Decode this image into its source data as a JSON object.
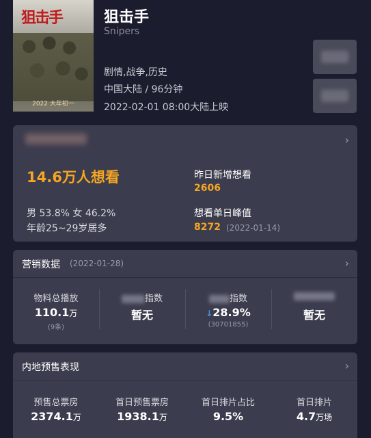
{
  "movie": {
    "title": "狙击手",
    "english_title": "Snipers",
    "genre": "剧情,战争,历史",
    "region_duration": "中国大陆 / 96分钟",
    "release": "2022-02-01 08:00大陆上映",
    "poster": {
      "logo_text": "狙击手",
      "date_text": "2022 大年初一"
    }
  },
  "want_card": {
    "want_text": "14.6万人想看",
    "gender_text": "男 53.8% 女 46.2%",
    "age_text": "年龄25~29岁居多",
    "yesterday_label": "昨日新增想看",
    "yesterday_value": "2606",
    "peak_label": "想看单日峰值",
    "peak_value": "8272",
    "peak_date": "(2022-01-14)"
  },
  "marketing": {
    "title": "营销数据",
    "date": "(2022-01-28)",
    "metrics": [
      {
        "label": "物料总播放",
        "value": "110.1",
        "unit": "万",
        "sub": "(9条)"
      },
      {
        "label_suffix": "指数",
        "value": "暂无"
      },
      {
        "label_suffix": "指数",
        "value": "28.9%",
        "sub": "(30701855)"
      },
      {
        "value": "暂无"
      }
    ]
  },
  "presale": {
    "title": "内地预售表现",
    "metrics": [
      {
        "label": "预售总票房",
        "value": "2374.1",
        "unit": "万"
      },
      {
        "label": "首日预售票房",
        "value": "1938.1",
        "unit": "万"
      },
      {
        "label": "首日排片占比",
        "value": "9.5%"
      },
      {
        "label": "首日排片",
        "value": "4.7",
        "unit": "万场"
      }
    ]
  },
  "icons": {
    "chevron": "›",
    "down_arrow": "↓"
  },
  "colors": {
    "accent": "#f6a623",
    "background": "#1b1c2e",
    "card": "#3b3c4d",
    "down": "#4a90e2"
  }
}
